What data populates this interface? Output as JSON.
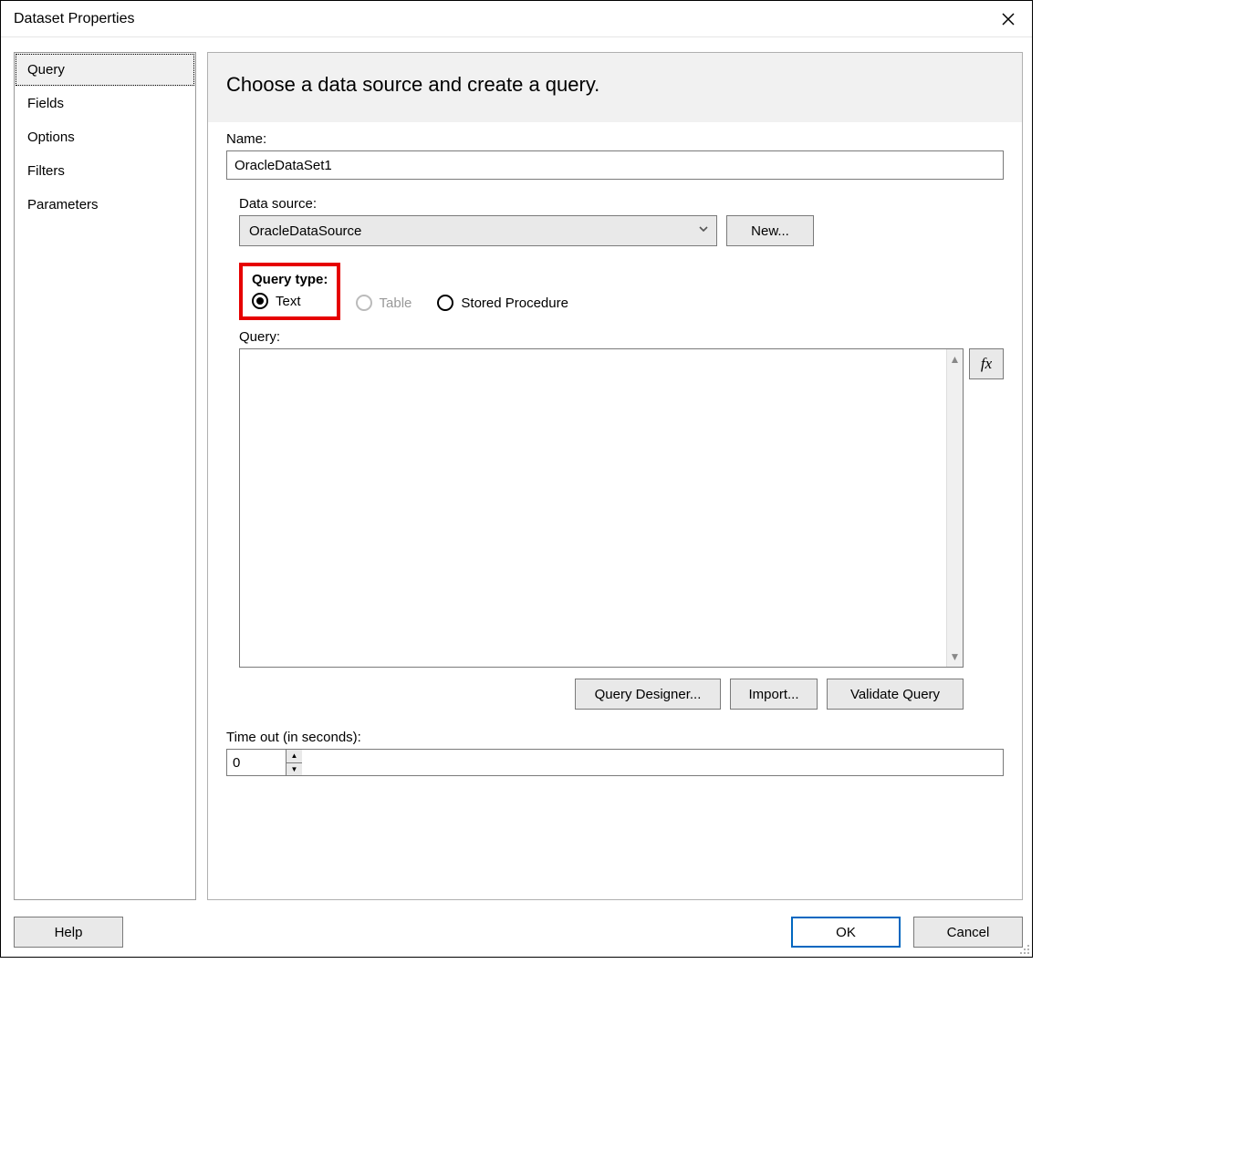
{
  "dialog": {
    "title": "Dataset Properties"
  },
  "sidebar": {
    "items": [
      {
        "label": "Query",
        "selected": true
      },
      {
        "label": "Fields",
        "selected": false
      },
      {
        "label": "Options",
        "selected": false
      },
      {
        "label": "Filters",
        "selected": false
      },
      {
        "label": "Parameters",
        "selected": false
      }
    ]
  },
  "main": {
    "heading": "Choose a data source and create a query.",
    "name_label": "Name:",
    "name_value": "OracleDataSet1",
    "datasource_label": "Data source:",
    "datasource_value": "OracleDataSource",
    "new_button": "New...",
    "querytype_label": "Query type:",
    "querytype_options": {
      "text": "Text",
      "table": "Table",
      "sproc": "Stored Procedure"
    },
    "query_label": "Query:",
    "query_value": "",
    "fx_label": "fx",
    "query_designer_button": "Query Designer...",
    "import_button": "Import...",
    "validate_button": "Validate Query",
    "timeout_label": "Time out (in seconds):",
    "timeout_value": "0"
  },
  "footer": {
    "help": "Help",
    "ok": "OK",
    "cancel": "Cancel"
  }
}
